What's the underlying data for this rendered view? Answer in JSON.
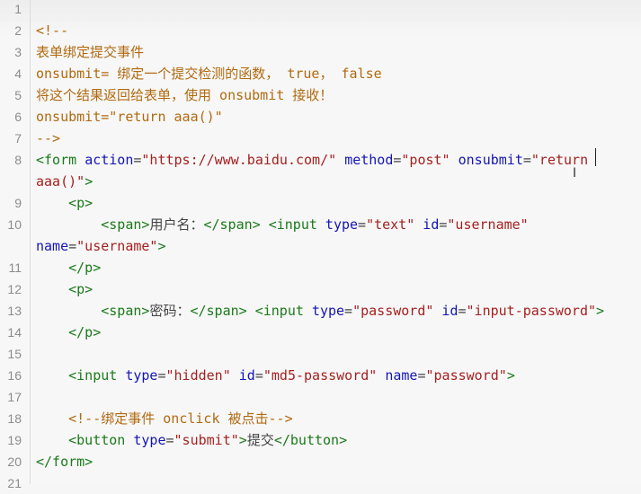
{
  "editor": {
    "lines": [
      {
        "n": "1",
        "rows": [
          []
        ]
      },
      {
        "n": "2",
        "rows": [
          [
            [
              "com",
              "<!--"
            ]
          ]
        ]
      },
      {
        "n": "3",
        "rows": [
          [
            [
              "com",
              "表单绑定提交事件"
            ]
          ]
        ]
      },
      {
        "n": "4",
        "rows": [
          [
            [
              "com",
              "onsubmit= 绑定一个提交检测的函数， true， false"
            ]
          ]
        ]
      },
      {
        "n": "5",
        "rows": [
          [
            [
              "com",
              "将这个结果返回给表单，使用 onsubmit 接收！"
            ]
          ]
        ]
      },
      {
        "n": "6",
        "rows": [
          [
            [
              "com",
              "onsubmit=\"return aaa()\""
            ]
          ]
        ]
      },
      {
        "n": "7",
        "rows": [
          [
            [
              "com",
              "-->"
            ]
          ]
        ]
      },
      {
        "n": "8",
        "rows": [
          [
            [
              "tag",
              "<form"
            ],
            [
              "txt",
              " "
            ],
            [
              "attr",
              "action"
            ],
            [
              "txt",
              "="
            ],
            [
              "str",
              "\"https://www.baidu.com/\""
            ],
            [
              "txt",
              " "
            ],
            [
              "attr",
              "method"
            ],
            [
              "txt",
              "="
            ],
            [
              "str",
              "\"post\""
            ],
            [
              "txt",
              " "
            ],
            [
              "attr",
              "onsubmit"
            ],
            [
              "txt",
              "="
            ],
            [
              "str",
              "\"return"
            ]
          ],
          [
            [
              "str",
              "aaa()\""
            ],
            [
              "tag",
              ">"
            ]
          ]
        ]
      },
      {
        "n": "9",
        "rows": [
          [
            [
              "txt",
              "    "
            ],
            [
              "tag",
              "<p>"
            ]
          ]
        ]
      },
      {
        "n": "10",
        "rows": [
          [
            [
              "txt",
              "        "
            ],
            [
              "tag",
              "<span>"
            ],
            [
              "txt",
              "用户名："
            ],
            [
              "tag",
              "</span>"
            ],
            [
              "txt",
              " "
            ],
            [
              "tag",
              "<input"
            ],
            [
              "txt",
              " "
            ],
            [
              "attr",
              "type"
            ],
            [
              "txt",
              "="
            ],
            [
              "str",
              "\"text\""
            ],
            [
              "txt",
              " "
            ],
            [
              "attr",
              "id"
            ],
            [
              "txt",
              "="
            ],
            [
              "str",
              "\"username\""
            ]
          ],
          [
            [
              "attr",
              "name"
            ],
            [
              "txt",
              "="
            ],
            [
              "str",
              "\"username\""
            ],
            [
              "tag",
              ">"
            ]
          ]
        ]
      },
      {
        "n": "11",
        "rows": [
          [
            [
              "txt",
              "    "
            ],
            [
              "tag",
              "</p>"
            ]
          ]
        ]
      },
      {
        "n": "12",
        "rows": [
          [
            [
              "txt",
              "    "
            ],
            [
              "tag",
              "<p>"
            ]
          ]
        ]
      },
      {
        "n": "13",
        "rows": [
          [
            [
              "txt",
              "        "
            ],
            [
              "tag",
              "<span>"
            ],
            [
              "txt",
              "密码："
            ],
            [
              "tag",
              "</span>"
            ],
            [
              "txt",
              " "
            ],
            [
              "tag",
              "<input"
            ],
            [
              "txt",
              " "
            ],
            [
              "attr",
              "type"
            ],
            [
              "txt",
              "="
            ],
            [
              "str",
              "\"password\""
            ],
            [
              "txt",
              " "
            ],
            [
              "attr",
              "id"
            ],
            [
              "txt",
              "="
            ],
            [
              "str",
              "\"input-password\""
            ],
            [
              "tag",
              ">"
            ]
          ]
        ]
      },
      {
        "n": "14",
        "rows": [
          [
            [
              "txt",
              "    "
            ],
            [
              "tag",
              "</p>"
            ]
          ]
        ]
      },
      {
        "n": "15",
        "rows": [
          []
        ]
      },
      {
        "n": "16",
        "rows": [
          [
            [
              "txt",
              "    "
            ],
            [
              "tag",
              "<input"
            ],
            [
              "txt",
              " "
            ],
            [
              "attr",
              "type"
            ],
            [
              "txt",
              "="
            ],
            [
              "str",
              "\"hidden\""
            ],
            [
              "txt",
              " "
            ],
            [
              "attr",
              "id"
            ],
            [
              "txt",
              "="
            ],
            [
              "str",
              "\"md5-password\""
            ],
            [
              "txt",
              " "
            ],
            [
              "attr",
              "name"
            ],
            [
              "txt",
              "="
            ],
            [
              "str",
              "\"password\""
            ],
            [
              "tag",
              ">"
            ]
          ]
        ]
      },
      {
        "n": "17",
        "rows": [
          []
        ]
      },
      {
        "n": "18",
        "rows": [
          [
            [
              "txt",
              "    "
            ],
            [
              "com",
              "<!--绑定事件 onclick 被点击-->"
            ]
          ]
        ]
      },
      {
        "n": "19",
        "rows": [
          [
            [
              "txt",
              "    "
            ],
            [
              "tag",
              "<button"
            ],
            [
              "txt",
              " "
            ],
            [
              "attr",
              "type"
            ],
            [
              "txt",
              "="
            ],
            [
              "str",
              "\"submit\""
            ],
            [
              "tag",
              ">"
            ],
            [
              "txt",
              "提交"
            ],
            [
              "tag",
              "</button>"
            ]
          ]
        ]
      },
      {
        "n": "20",
        "rows": [
          [
            [
              "tag",
              "</form>"
            ]
          ]
        ]
      },
      {
        "n": "21",
        "rows": [
          []
        ]
      }
    ]
  }
}
